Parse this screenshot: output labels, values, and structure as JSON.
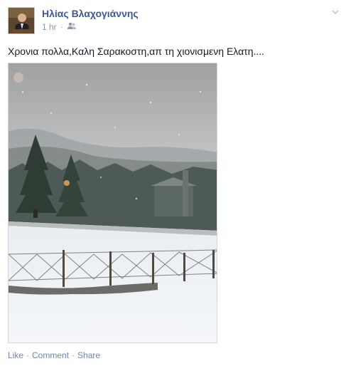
{
  "post": {
    "author": "Ηλίας Βλαχογιάννης",
    "timestamp": "1 hr",
    "separator": "·",
    "privacy_icon": "friends-icon",
    "text": "Χρονια πολλα,Καλη Σαρακοστη,απ τη χιονισμενη Ελατη...."
  },
  "actions": {
    "like": "Like",
    "comment": "Comment",
    "share": "Share",
    "sep": "·"
  }
}
